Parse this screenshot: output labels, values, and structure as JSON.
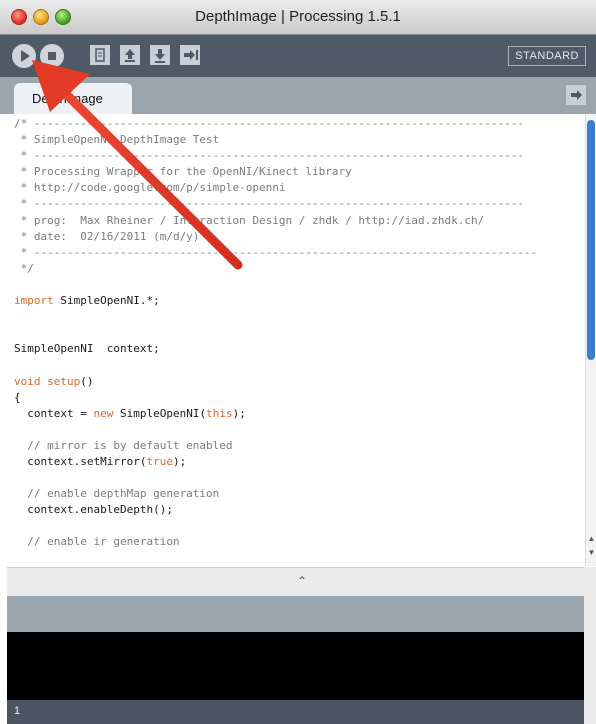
{
  "window": {
    "title": "DepthImage | Processing 1.5.1"
  },
  "toolbar": {
    "buttons": [
      "run",
      "stop",
      "new",
      "open",
      "save",
      "export"
    ],
    "mode": "STANDARD"
  },
  "tabs": [
    {
      "label": "DepthImage"
    }
  ],
  "editor": {
    "lines": [
      [
        {
          "t": "/* --------------------------------------------------------------------------",
          "c": "cm"
        }
      ],
      [
        {
          "t": " * SimpleOpenNI DepthImage Test",
          "c": "cm"
        }
      ],
      [
        {
          "t": " * --------------------------------------------------------------------------",
          "c": "cm"
        }
      ],
      [
        {
          "t": " * Processing Wrapper for the OpenNI/Kinect library",
          "c": "cm"
        }
      ],
      [
        {
          "t": " * http://code.google.com/p/simple-openni",
          "c": "cm"
        }
      ],
      [
        {
          "t": " * --------------------------------------------------------------------------",
          "c": "cm"
        }
      ],
      [
        {
          "t": " * prog:  Max Rheiner / Interaction Design / zhdk / http://iad.zhdk.ch/",
          "c": "cm"
        }
      ],
      [
        {
          "t": " * date:  02/16/2011 (m/d/y)",
          "c": "cm"
        }
      ],
      [
        {
          "t": " * ----------------------------------------------------------------------------",
          "c": "cm"
        }
      ],
      [
        {
          "t": " */",
          "c": "cm"
        }
      ],
      [
        {
          "t": ""
        }
      ],
      [
        {
          "t": "import",
          "c": "kw"
        },
        {
          "t": " SimpleOpenNI.*;"
        }
      ],
      [
        {
          "t": ""
        }
      ],
      [
        {
          "t": ""
        }
      ],
      [
        {
          "t": "SimpleOpenNI  context;"
        }
      ],
      [
        {
          "t": ""
        }
      ],
      [
        {
          "t": "void",
          "c": "kw"
        },
        {
          "t": " "
        },
        {
          "t": "setup",
          "c": "kw"
        },
        {
          "t": "()"
        }
      ],
      [
        {
          "t": "{"
        }
      ],
      [
        {
          "t": "  context = "
        },
        {
          "t": "new",
          "c": "kw"
        },
        {
          "t": " SimpleOpenNI("
        },
        {
          "t": "this",
          "c": "kw"
        },
        {
          "t": ");"
        }
      ],
      [
        {
          "t": ""
        }
      ],
      [
        {
          "t": "  // mirror is by default enabled",
          "c": "cm"
        }
      ],
      [
        {
          "t": "  context.setMirror("
        },
        {
          "t": "true",
          "c": "kw"
        },
        {
          "t": ");"
        }
      ],
      [
        {
          "t": ""
        }
      ],
      [
        {
          "t": "  // enable depthMap generation",
          "c": "cm"
        }
      ],
      [
        {
          "t": "  context.enableDepth();"
        }
      ],
      [
        {
          "t": ""
        }
      ],
      [
        {
          "t": "  // enable ir generation",
          "c": "cm"
        }
      ]
    ]
  },
  "status": {
    "line_number": "1"
  },
  "icons": {
    "run": "play-icon",
    "stop": "stop-icon",
    "new": "new-file-icon",
    "open": "open-arrow-icon",
    "save": "save-arrow-icon",
    "export": "export-icon",
    "tab_menu": "arrow-right-icon",
    "collapse": "chevron-up-icon"
  },
  "colors": {
    "accent": "#3a7ed4",
    "annotation": "#e63a27",
    "keyword": "#d86a2b",
    "toolbar": "#4f5a66"
  }
}
